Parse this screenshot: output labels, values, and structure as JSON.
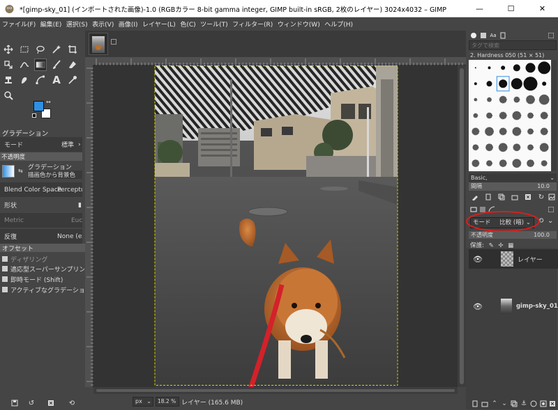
{
  "window": {
    "title": "*[gimp-sky_01] (インポートされた画像)-1.0 (RGBカラー 8-bit gamma integer, GIMP built-in sRGB, 2枚のレイヤー) 3024x4032 – GIMP",
    "min_label": "—",
    "max_label": "☐",
    "close_label": "✕"
  },
  "menubar": {
    "items": [
      "ファイル(F)",
      "編集(E)",
      "選択(S)",
      "表示(V)",
      "画像(I)",
      "レイヤー(L)",
      "色(C)",
      "ツール(T)",
      "フィルター(R)",
      "ウィンドウ(W)",
      "ヘルプ(H)"
    ]
  },
  "toolbox": {
    "active_tool": "gradient-tool",
    "fg_color": "#2f8fe3",
    "bg_color": "#ffffff"
  },
  "tool_options": {
    "title": "グラデーション",
    "mode_label": "モード",
    "mode_value": "標準",
    "opacity_label": "不透明度",
    "gradient_label": "グラデーション",
    "gradient_value": "描画色から背景色",
    "blend_label": "Blend Color Space",
    "blend_value": "Perceptual",
    "shape_label": "形状",
    "metric_label": "Metric",
    "metric_value": "Euclid",
    "repeat_label": "反復",
    "repeat_value": "None (ex",
    "offset_label": "オフセット",
    "dithering_label": "ディザリング",
    "dithering_checked": true,
    "supersample_label": "適応型スーパーサンプリン",
    "instant_label": "即時モード (Shift)",
    "active_gradient_label": "アクティブなグラデーショ"
  },
  "status": {
    "unit": "px",
    "zoom": "18.2 %",
    "layer_info": "レイヤー (165.6 MB)"
  },
  "brushes": {
    "filter_placeholder": "タグで検索",
    "selected_name": "2. Hardness 050 (51 × 51)",
    "preset": "Basic,",
    "spacing_label": "間隔",
    "spacing_value": "10.0"
  },
  "layers": {
    "mode_label": "モード",
    "mode_value": "比較 (暗)",
    "opacity_label": "不透明度",
    "opacity_value": "100.0",
    "lock_label": "保護:",
    "items": [
      {
        "name": "レイヤー"
      },
      {
        "name": "gimp-sky_01"
      }
    ],
    "highlight_color": "#d42020"
  }
}
